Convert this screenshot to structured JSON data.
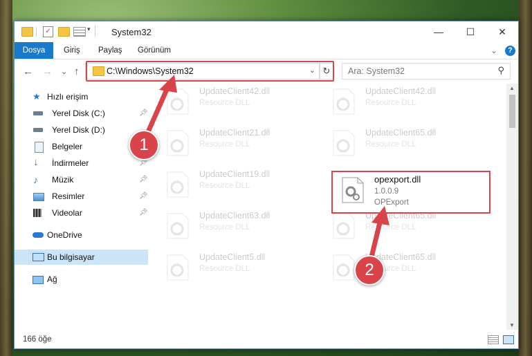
{
  "window": {
    "title": "System32",
    "minimize": "—",
    "maximize": "☐",
    "close": "✕"
  },
  "ribbon": {
    "tabs": [
      "Dosya",
      "Giriş",
      "Paylaş",
      "Görünüm"
    ],
    "collapse": "⌄",
    "help": "?"
  },
  "nav": {
    "back": "←",
    "forward": "→",
    "recent": "⌄",
    "up": "↑",
    "address": "C:\\Windows\\System32",
    "refresh": "↻",
    "search_placeholder": "Ara: System32"
  },
  "sidebar": {
    "quick_access": "Hızlı erişim",
    "items": [
      {
        "label": "Yerel Disk (C:)",
        "icon": "drive-icon",
        "pinned": true
      },
      {
        "label": "Yerel Disk (D:)",
        "icon": "drive-icon",
        "pinned": true
      },
      {
        "label": "Belgeler",
        "icon": "documents-icon",
        "pinned": true
      },
      {
        "label": "İndirmeler",
        "icon": "download-icon",
        "pinned": true
      },
      {
        "label": "Müzik",
        "icon": "music-icon",
        "pinned": true
      },
      {
        "label": "Resimler",
        "icon": "pictures-icon",
        "pinned": true
      },
      {
        "label": "Videolar",
        "icon": "videos-icon",
        "pinned": true
      }
    ],
    "onedrive": "OneDrive",
    "this_pc": "Bu bilgisayar",
    "network": "Ağ"
  },
  "files": [
    {
      "name": "UpdateClient42.dll",
      "desc": "Resource DLL",
      "faded": true
    },
    {
      "name": "UpdateClient42.dll",
      "desc": "Resource DLL",
      "faded": true
    },
    {
      "name": "UpdateClient21.dll",
      "desc": "Resource DLL",
      "faded": true
    },
    {
      "name": "UpdateClient65.dll",
      "desc": "Resource DLL",
      "faded": true
    },
    {
      "name": "UpdateClient19.dll",
      "desc": "Resource DLL",
      "faded": true
    },
    {
      "name": "opexport.dll",
      "version": "1.0.0.9",
      "desc": "OPExport",
      "faded": false
    },
    {
      "name": "UpdateClient63.dll",
      "desc": "Resource DLL",
      "faded": true
    },
    {
      "name": "UpdateClient65.dll",
      "desc": "Resource DLL",
      "faded": true
    },
    {
      "name": "UpdateClient5.dll",
      "desc": "Resource DLL",
      "faded": true
    },
    {
      "name": "UpdateClient65.dll",
      "desc": "Resource DLL",
      "faded": true
    }
  ],
  "status": {
    "count": "166 öğe"
  },
  "annotations": {
    "step1": "1",
    "step2": "2",
    "color": "#d9434a"
  }
}
